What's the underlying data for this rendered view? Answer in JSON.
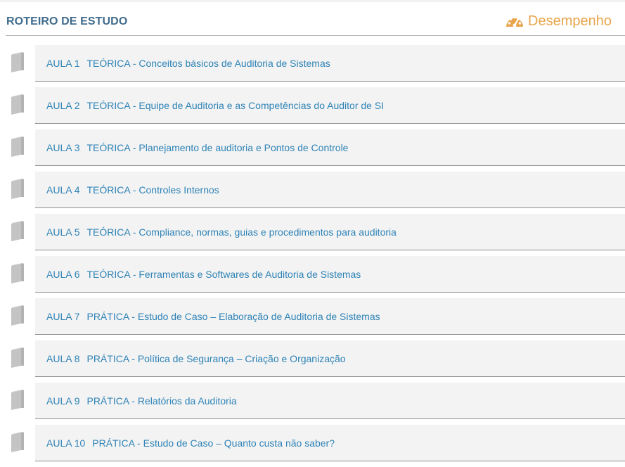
{
  "header": {
    "title": "ROTEIRO DE ESTUDO",
    "performance_label": "Desempenho",
    "performance_icon": "gauge-icon"
  },
  "colors": {
    "title": "#3f6b8c",
    "link": "#2e83b6",
    "accent": "#e9a54b",
    "row_bg": "#f3f3f3"
  },
  "lessons": [
    {
      "number": "AULA 1",
      "title": "TEÓRICA - Conceitos básicos de Auditoria de Sistemas",
      "icon": "book-icon"
    },
    {
      "number": "AULA 2",
      "title": "TEÓRICA - Equipe de Auditoria e as Competências do Auditor de SI",
      "icon": "book-icon"
    },
    {
      "number": "AULA 3",
      "title": "TEÓRICA - Planejamento de auditoria e Pontos de Controle",
      "icon": "book-icon"
    },
    {
      "number": "AULA 4",
      "title": "TEÓRICA - Controles Internos",
      "icon": "book-icon"
    },
    {
      "number": "AULA 5",
      "title": "TEÓRICA - Compliance, normas, guias e procedimentos para auditoria",
      "icon": "book-icon"
    },
    {
      "number": "AULA 6",
      "title": "TEÓRICA - Ferramentas e Softwares de Auditoria de Sistemas",
      "icon": "book-icon"
    },
    {
      "number": "AULA 7",
      "title": "PRÁTICA - Estudo de Caso – Elaboração de Auditoria de Sistemas",
      "icon": "book-icon"
    },
    {
      "number": "AULA 8",
      "title": "PRÁTICA - Política de Segurança – Criação e Organização",
      "icon": "book-icon"
    },
    {
      "number": "AULA 9",
      "title": "PRÁTICA - Relatórios da Auditoria",
      "icon": "book-icon"
    },
    {
      "number": "AULA 10",
      "title": "PRÁTICA - Estudo de Caso – Quanto custa não saber?",
      "icon": "book-icon"
    }
  ]
}
